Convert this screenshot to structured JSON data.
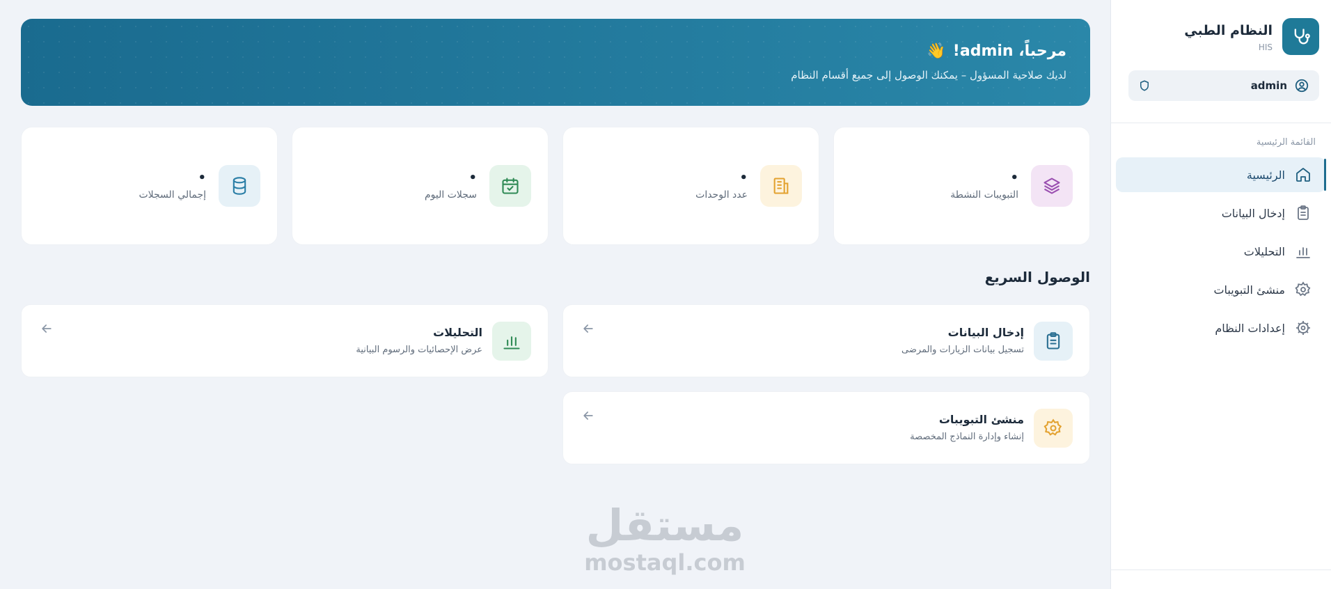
{
  "brand": {
    "title": "النظام الطبي",
    "subtitle": "HIS"
  },
  "user": {
    "name": "admin"
  },
  "sidebar": {
    "section_label": "القائمة الرئيسية",
    "items": [
      {
        "label": "الرئيسية",
        "icon": "home-icon",
        "active": true
      },
      {
        "label": "إدخال البيانات",
        "icon": "clipboard-icon"
      },
      {
        "label": "التحليلات",
        "icon": "bar-chart-icon"
      },
      {
        "label": "منشئ التبويبات",
        "icon": "gear-icon"
      },
      {
        "label": "إعدادات النظام",
        "icon": "settings-icon"
      }
    ]
  },
  "banner": {
    "title": "مرحباً، admin!",
    "emoji": "👋",
    "subtitle": "لديك صلاحية المسؤول – يمكنك الوصول إلى جميع أقسام النظام"
  },
  "stats": [
    {
      "label": "إجمالي السجلات",
      "value": "•",
      "icon": "database-icon",
      "color": "#2a7ea6",
      "bg": "#e6f1f7"
    },
    {
      "label": "سجلات اليوم",
      "value": "•",
      "icon": "calendar-icon",
      "color": "#2f8a55",
      "bg": "#e5f4ea"
    },
    {
      "label": "عدد الوحدات",
      "value": "•",
      "icon": "building-icon",
      "color": "#e3a230",
      "bg": "#fdf3de"
    },
    {
      "label": "التبويبات النشطة",
      "value": "•",
      "icon": "layers-icon",
      "color": "#9a4fb0",
      "bg": "#f3e4f5"
    }
  ],
  "quick_access": {
    "title": "الوصول السريع",
    "items": [
      {
        "title": "إدخال البيانات",
        "desc": "تسجيل بيانات الزيارات والمرضى",
        "icon": "clipboard-icon",
        "color": "#2a6f92",
        "bg": "#e6f1f7"
      },
      {
        "title": "التحليلات",
        "desc": "عرض الإحصائيات والرسوم البيانية",
        "icon": "bar-chart-icon",
        "color": "#2f8a55",
        "bg": "#e5f4ea"
      },
      {
        "title": "منشئ التبويبات",
        "desc": "إنشاء وإدارة النماذج المخصصة",
        "icon": "gear-icon",
        "color": "#e3a230",
        "bg": "#fdf3de"
      }
    ]
  },
  "watermark": {
    "arabic": "مستقل",
    "latin": "mostaql.com"
  }
}
